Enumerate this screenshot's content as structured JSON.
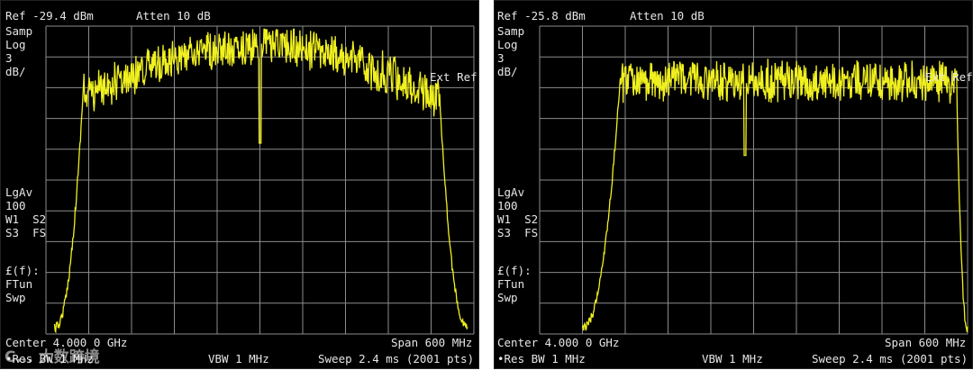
{
  "colors": {
    "background": "#000000",
    "grid": "#8c8c8c",
    "trace": "#f0f020",
    "text": "#e6e6e6"
  },
  "screens": [
    {
      "ref": "Ref -29.4 dBm",
      "atten": "Atten 10 dB",
      "samp": "Samp",
      "log": "Log",
      "scale": "3",
      "unit": "dB/",
      "ext_ref": "Ext Ref",
      "lgav": "LgAv",
      "avg": "100",
      "w1s2": "W1  S2",
      "s3fs": "S3  FS",
      "ff": "£(f):",
      "ftun": "FTun",
      "swp": "Swp",
      "center": "Center 4.000 0 GHz",
      "span": "Span 600 MHz",
      "rbw": "•Res BW 1 MHz",
      "vbw": "VBW 1 MHz",
      "sweep": "Sweep 2.4 ms (2001 pts)",
      "watermark": "C... 大数跨境"
    },
    {
      "ref": "Ref -25.8 dBm",
      "atten": "Atten 10 dB",
      "samp": "Samp",
      "log": "Log",
      "scale": "3",
      "unit": "dB/",
      "ext_ref": "Ext Ref",
      "lgav": "LgAv",
      "avg": "100",
      "w1s2": "W1  S2",
      "s3fs": "S3  FS",
      "ff": "£(f):",
      "ftun": "FTun",
      "swp": "Swp",
      "center": "Center 4.000 0 GHz",
      "span": "Span 600 MHz",
      "rbw": "•Res BW 1 MHz",
      "vbw": "VBW 1 MHz",
      "sweep": "Sweep 2.4 ms (2001 pts)",
      "watermark": ""
    }
  ]
}
